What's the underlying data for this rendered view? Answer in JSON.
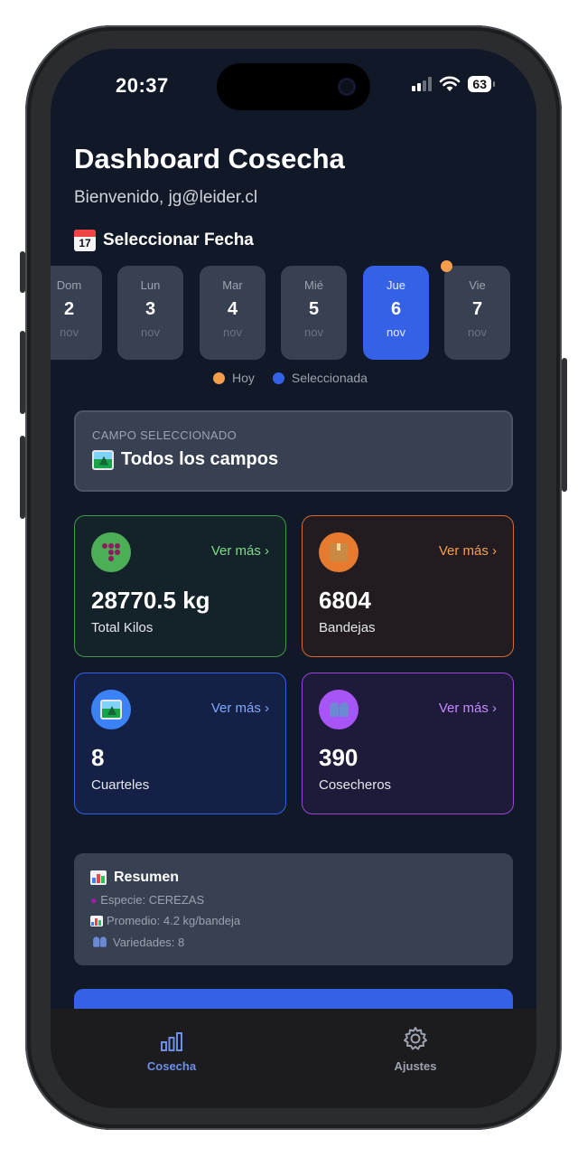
{
  "status": {
    "time": "20:37",
    "battery": "63"
  },
  "header": {
    "title": "Dashboard Cosecha",
    "welcome": "Bienvenido, jg@leider.cl",
    "select_date_label": "Seleccionar Fecha",
    "calendar_icon_day": "17"
  },
  "days": [
    {
      "name": "Dom",
      "num": "2",
      "month": "nov",
      "selected": false,
      "today": false
    },
    {
      "name": "Lun",
      "num": "3",
      "month": "nov",
      "selected": false,
      "today": false
    },
    {
      "name": "Mar",
      "num": "4",
      "month": "nov",
      "selected": false,
      "today": false
    },
    {
      "name": "Mié",
      "num": "5",
      "month": "nov",
      "selected": false,
      "today": false
    },
    {
      "name": "Jue",
      "num": "6",
      "month": "nov",
      "selected": true,
      "today": false
    },
    {
      "name": "Vie",
      "num": "7",
      "month": "nov",
      "selected": false,
      "today": true
    }
  ],
  "legend": {
    "today": "Hoy",
    "selected": "Seleccionada",
    "today_color": "#f59e4b",
    "selected_color": "#3461e6"
  },
  "campo": {
    "label": "CAMPO SELECCIONADO",
    "value": "Todos los campos",
    "icon": "landscape-icon"
  },
  "stats": [
    {
      "id": "kilos",
      "value": "28770.5 kg",
      "label": "Total Kilos",
      "more": "Ver más ›",
      "icon": "grapes-icon",
      "color": "#4caf56"
    },
    {
      "id": "bandejas",
      "value": "6804",
      "label": "Bandejas",
      "more": "Ver más ›",
      "icon": "box-icon",
      "color": "#e67a2e"
    },
    {
      "id": "cuarteles",
      "value": "8",
      "label": "Cuarteles",
      "more": "Ver más ›",
      "icon": "landscape-icon",
      "color": "#3b82f6"
    },
    {
      "id": "cosecheros",
      "value": "390",
      "label": "Cosecheros",
      "more": "Ver más ›",
      "icon": "people-icon",
      "color": "#a855f7"
    }
  ],
  "resumen": {
    "title": "Resumen",
    "especie": "Especie: CEREZAS",
    "promedio": "Promedio: 4.2 kg/bandeja",
    "variedades": "Variedades: 8"
  },
  "tabbar": {
    "cosecha": "Cosecha",
    "ajustes": "Ajustes"
  }
}
